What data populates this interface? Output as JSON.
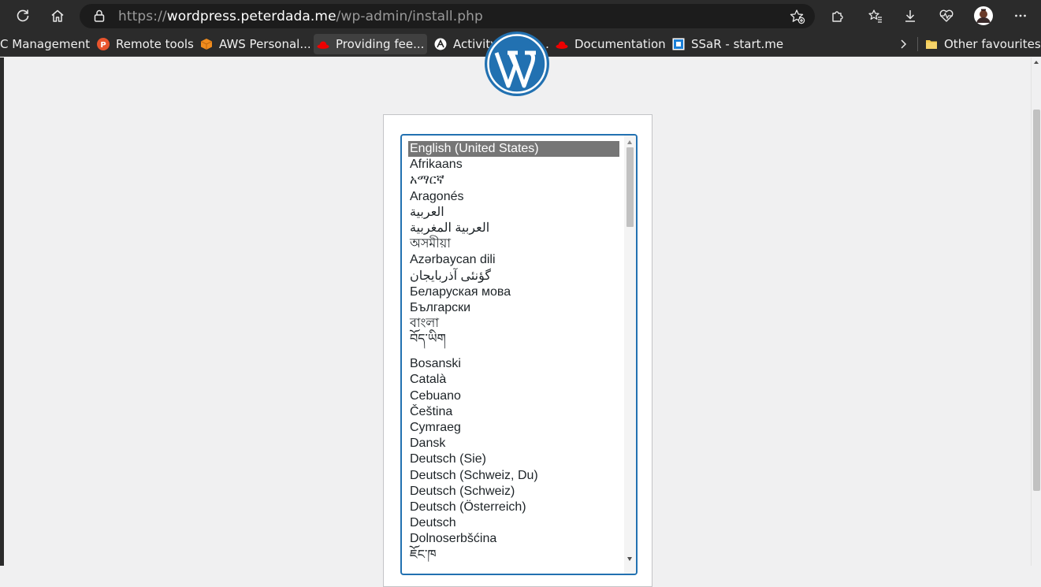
{
  "browser": {
    "url_prefix": "https://",
    "url_host": "wordpress.peterdada.me",
    "url_path": "/wp-admin/install.php",
    "profile_accent": "#b47a5a"
  },
  "bookmarks": [
    {
      "label": "PC Management",
      "icon": "none"
    },
    {
      "label": "Remote tools",
      "icon": "p-circle-icon"
    },
    {
      "label": "AWS Personal...",
      "icon": "aws-cube-icon"
    },
    {
      "label": "Providing fee...",
      "icon": "redhat-icon"
    },
    {
      "label": "Activity Watch...",
      "icon": "activitywatch-icon"
    },
    {
      "label": "Documentation",
      "icon": "redhat-icon"
    },
    {
      "label": "SSaR - start.me",
      "icon": "startme-icon"
    }
  ],
  "other_favourites": "Other favourites",
  "colors": {
    "accent": "#2271b1",
    "selected_bg": "#767676",
    "wp_blue": "#2271b1"
  },
  "language_select": {
    "options": [
      "English (United States)",
      "Afrikaans",
      "አማርኛ",
      "Aragonés",
      "العربية",
      "العربية المغربية",
      "অসমীয়া",
      "Azərbaycan dili",
      "گؤنئی آذربایجان",
      "Беларуская мова",
      "Български",
      "বাংলা",
      "བོད་ཡིག",
      "Bosanski",
      "Català",
      "Cebuano",
      "Čeština",
      "Cymraeg",
      "Dansk",
      "Deutsch (Sie)",
      "Deutsch (Schweiz, Du)",
      "Deutsch (Schweiz)",
      "Deutsch (Österreich)",
      "Deutsch",
      "Dolnoserbšćina",
      "ཇོང་ཁ"
    ],
    "selected": "English (United States)"
  }
}
